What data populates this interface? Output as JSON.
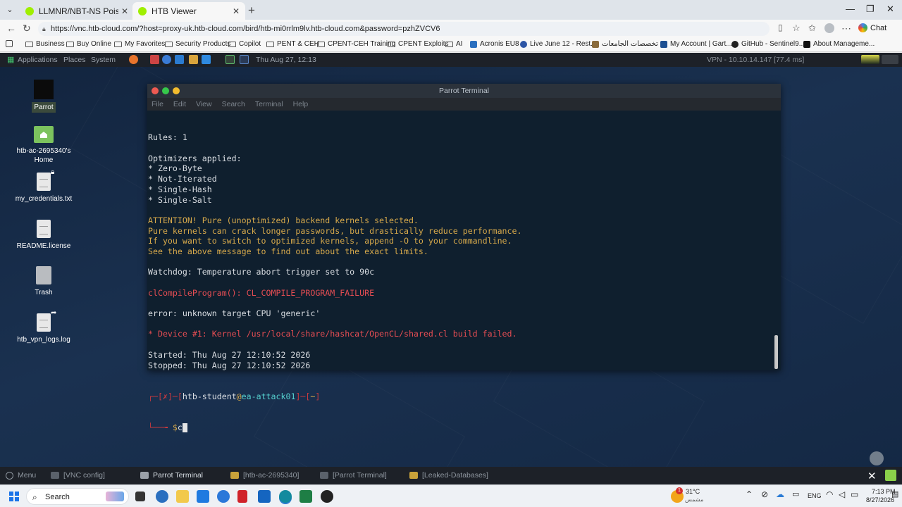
{
  "browser": {
    "tabs": [
      {
        "label": "LLMNR/NBT-NS Poisoning - from",
        "favicon_color": "#9fef00"
      },
      {
        "label": "HTB Viewer",
        "favicon_color": "#9fef00"
      }
    ],
    "new_tab": "+",
    "url": "https://vnc.htb-cloud.com/?host=proxy-uk.htb-cloud.com/bird/htb-mi0rrlm9lv.htb-cloud.com&password=pzhZVCV6",
    "chat_label": "Chat",
    "bookmarks": [
      {
        "label": "Business"
      },
      {
        "label": "Buy Online"
      },
      {
        "label": "My Favorites"
      },
      {
        "label": "Security Products"
      },
      {
        "label": "Copilot"
      },
      {
        "label": "PENT & CEH"
      },
      {
        "label": "CPENT-CEH Training"
      },
      {
        "label": "CPENT Exploits"
      },
      {
        "label": "AI"
      },
      {
        "label": "Acronis EU8"
      },
      {
        "label": "Live June 12 - Rest..."
      },
      {
        "label": "تخصصات الجامعات"
      },
      {
        "label": "My Account | Gart..."
      },
      {
        "label": "GitHub - Sentinel9..."
      },
      {
        "label": "About Manageme..."
      }
    ]
  },
  "parrot_top": {
    "applications": "Applications",
    "places": "Places",
    "system": "System",
    "clock": "Thu Aug 27, 12:13",
    "vpn": "VPN - 10.10.14.147 [77.4 ms]"
  },
  "desktop_icons": [
    {
      "label": "Parrot"
    },
    {
      "label": "htb-ac-2695340's Home"
    },
    {
      "label": "my_credentials.txt"
    },
    {
      "label": "README.license"
    },
    {
      "label": "Trash"
    },
    {
      "label": "htb_vpn_logs.log"
    }
  ],
  "terminal": {
    "title": "Parrot Terminal",
    "menu": [
      "File",
      "Edit",
      "View",
      "Search",
      "Terminal",
      "Help"
    ],
    "lines": [
      {
        "text": "Rules: 1",
        "cls": ""
      },
      {
        "text": "",
        "cls": ""
      },
      {
        "text": "Optimizers applied:",
        "cls": ""
      },
      {
        "text": "* Zero-Byte",
        "cls": ""
      },
      {
        "text": "* Not-Iterated",
        "cls": ""
      },
      {
        "text": "* Single-Hash",
        "cls": ""
      },
      {
        "text": "* Single-Salt",
        "cls": ""
      },
      {
        "text": "",
        "cls": ""
      },
      {
        "text": "ATTENTION! Pure (unoptimized) backend kernels selected.",
        "cls": "c-orange"
      },
      {
        "text": "Pure kernels can crack longer passwords, but drastically reduce performance.",
        "cls": "c-orange"
      },
      {
        "text": "If you want to switch to optimized kernels, append -O to your commandline.",
        "cls": "c-orange"
      },
      {
        "text": "See the above message to find out about the exact limits.",
        "cls": "c-orange"
      },
      {
        "text": "",
        "cls": ""
      },
      {
        "text": "Watchdog: Temperature abort trigger set to 90c",
        "cls": ""
      },
      {
        "text": "",
        "cls": ""
      },
      {
        "text": "clCompileProgram(): CL_COMPILE_PROGRAM_FAILURE",
        "cls": "c-red"
      },
      {
        "text": "",
        "cls": ""
      },
      {
        "text": "error: unknown target CPU 'generic'",
        "cls": ""
      },
      {
        "text": "",
        "cls": ""
      },
      {
        "text": "* Device #1: Kernel /usr/local/share/hashcat/OpenCL/shared.cl build failed.",
        "cls": "c-red"
      },
      {
        "text": "",
        "cls": ""
      },
      {
        "text": "Started: Thu Aug 27 12:10:52 2026",
        "cls": ""
      },
      {
        "text": "Stopped: Thu Aug 27 12:10:52 2026",
        "cls": ""
      }
    ],
    "prompt": {
      "status": "✗",
      "user": "htb-student",
      "host": "ea-attack01",
      "dir": "~",
      "symbol": "$",
      "input": "c"
    }
  },
  "parrot_bottom": {
    "menu": "Menu",
    "items": [
      {
        "label": "[VNC config]",
        "active": false
      },
      {
        "label": "Parrot Terminal",
        "active": true
      },
      {
        "label": "[htb-ac-2695340]",
        "active": false
      },
      {
        "label": "[Parrot Terminal]",
        "active": false
      },
      {
        "label": "[Leaked-Databases]",
        "active": false
      }
    ]
  },
  "taskbar": {
    "search_placeholder": "Search",
    "weather_temp": "31°C",
    "weather_desc": "مشمس",
    "weather_badge": "1",
    "language": "ENG",
    "time": "7:13 PM",
    "date": "8/27/2026"
  }
}
